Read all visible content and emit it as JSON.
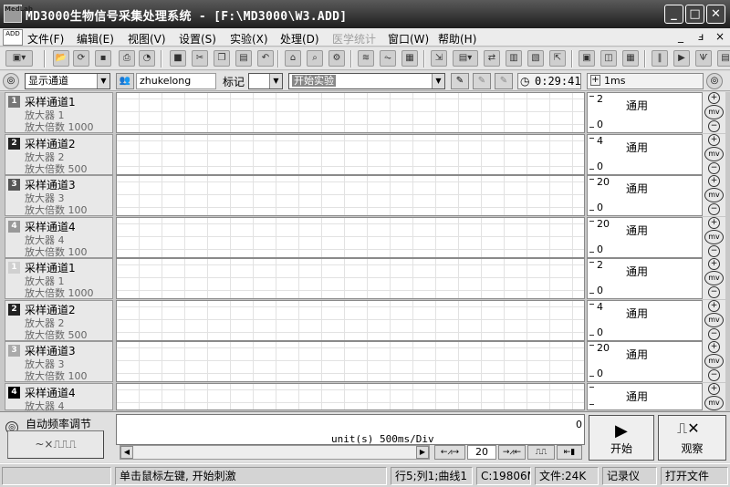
{
  "window": {
    "title": "MD3000生物信号采集处理系统 - [F:\\MD3000\\W3.ADD]",
    "app_icon_text": "MedLab",
    "controls": [
      "_",
      "□",
      "✕"
    ]
  },
  "menu": {
    "mdi_icon_text": "ADD",
    "items": [
      "文件(F)",
      "编辑(E)",
      "视图(V)",
      "设置(S)",
      "实验(X)",
      "处理(D)",
      "医学统计",
      "窗口(W)",
      "帮助(H)"
    ],
    "mdi_controls": [
      "_",
      "ⅎ",
      "×"
    ]
  },
  "control_bar": {
    "display_channel": "显示通道",
    "user_name": "zhukelong",
    "mark_label": "标记",
    "experiment": "开始实验",
    "timer": "0:29:41",
    "time_per_div": "1ms"
  },
  "channels": [
    {
      "num": "1",
      "name": "采样通道1",
      "amp": "放大器 1",
      "mag": "放大倍数 1000",
      "scale_top": "2",
      "scale_bottom": "0",
      "mode": "通用",
      "unit": "mv",
      "num_color": "#777777"
    },
    {
      "num": "2",
      "name": "采样通道2",
      "amp": "放大器 2",
      "mag": "放大倍数 500",
      "scale_top": "4",
      "scale_bottom": "0",
      "mode": "通用",
      "unit": "mv",
      "num_color": "#222222"
    },
    {
      "num": "3",
      "name": "采样通道3",
      "amp": "放大器 3",
      "mag": "放大倍数 100",
      "scale_top": "20",
      "scale_bottom": "0",
      "mode": "通用",
      "unit": "mv",
      "num_color": "#555555"
    },
    {
      "num": "4",
      "name": "采样通道4",
      "amp": "放大器 4",
      "mag": "放大倍数 100",
      "scale_top": "20",
      "scale_bottom": "0",
      "mode": "通用",
      "unit": "mv",
      "num_color": "#999999"
    },
    {
      "num": "1",
      "name": "采样通道1",
      "amp": "放大器 1",
      "mag": "放大倍数 1000",
      "scale_top": "2",
      "scale_bottom": "0",
      "mode": "通用",
      "unit": "mv",
      "num_color": "#d0d0d0"
    },
    {
      "num": "2",
      "name": "采样通道2",
      "amp": "放大器 2",
      "mag": "放大倍数 500",
      "scale_top": "4",
      "scale_bottom": "0",
      "mode": "通用",
      "unit": "mv",
      "num_color": "#222222"
    },
    {
      "num": "3",
      "name": "采样通道3",
      "amp": "放大器 3",
      "mag": "放大倍数 100",
      "scale_top": "20",
      "scale_bottom": "0",
      "mode": "通用",
      "unit": "mv",
      "num_color": "#aaaaaa"
    },
    {
      "num": "4",
      "name": "采样通道4",
      "amp": "放大器 4",
      "mag": "",
      "scale_top": "",
      "scale_bottom": "",
      "mode": "通用",
      "unit": "mv",
      "num_color": "#000000"
    }
  ],
  "bottom": {
    "auto_freq": "自动频率调节",
    "wave_button": "~×⎍⎍⎍",
    "unit_label": "unit(s) 500ms/Div",
    "right_mark": "0",
    "tc_value": "20",
    "start_label": "开始",
    "observe_label": "观察"
  },
  "status": {
    "hint": "单击鼠标左键, 开始刺激",
    "position": "行5;列1;曲线1",
    "memory": "C:19806M",
    "file": "文件:24K",
    "recorder": "记录仪",
    "open_file": "打开文件"
  }
}
